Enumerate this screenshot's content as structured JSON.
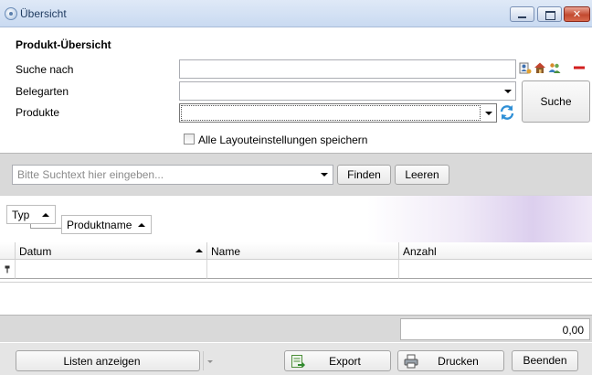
{
  "window": {
    "title": "Übersicht",
    "close_glyph": "✕",
    "icons": [
      "app-icon",
      "minimize-icon",
      "maximize-icon",
      "close-icon"
    ]
  },
  "form": {
    "heading": "Produkt-Übersicht",
    "search_label": "Suche nach",
    "search_value": "",
    "belegarten_label": "Belegarten",
    "belegarten_value": "",
    "produkte_label": "Produkte",
    "produkte_value": "",
    "search_button": "Suche",
    "checkbox_label": "Alle Layouteinstellungen speichern",
    "checkbox_checked": false,
    "tool_icons": [
      "person-card-icon",
      "house-icon",
      "users-icon",
      "remove-icon",
      "refresh-icon"
    ]
  },
  "filter": {
    "placeholder": "Bitte Suchtext hier eingeben...",
    "find_button": "Finden",
    "clear_button": "Leeren"
  },
  "grouping": {
    "tags": [
      "Typ",
      "Produktname"
    ]
  },
  "grid": {
    "columns": [
      "Datum",
      "Name",
      "Anzahl"
    ],
    "filter_row_icon": "pin-icon",
    "rows": []
  },
  "summary": {
    "total": "0,00"
  },
  "bottom": {
    "lists_button": "Listen anzeigen",
    "export_button": "Export",
    "print_button": "Drucken",
    "exit_button": "Beenden"
  },
  "colors": {
    "titlebar": "#c9daf1",
    "panel": "#d9d9d9",
    "accent_purple": "#dccfee",
    "refresh_blue": "#2e8fd6"
  }
}
